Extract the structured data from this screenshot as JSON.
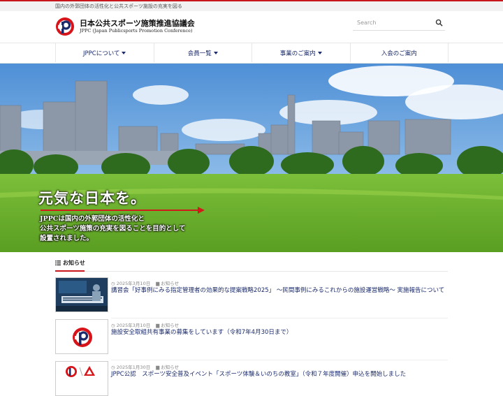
{
  "topbar": {
    "tagline": "国内の外郭団体の活性化と公共スポーツ施設の充実を図る"
  },
  "brand": {
    "title": "日本公共スポーツ施策推進協議会",
    "subtitle": "JPPC (Japan Publicsports Promotion Conference)",
    "color": "#d7141a"
  },
  "search": {
    "placeholder": "Search"
  },
  "nav": [
    {
      "label": "JPPCについて"
    },
    {
      "label": "会員一覧"
    },
    {
      "label": "事業のご案内"
    },
    {
      "label": "入会のご案内"
    }
  ],
  "hero": {
    "headline": "元気な日本を。",
    "body": [
      "JPPCは国内の外郭団体の活性化と",
      "公共スポーツ施策の充実を図ることを目的として",
      "設置されました。"
    ]
  },
  "news": {
    "heading": "お知らせ",
    "items": [
      {
        "date": "2025年3月10日",
        "category": "お知らせ",
        "title": "講習会「好事例にみる指定管理者の効果的な提案戦略2025」 ～民間事例にみるこれからの施設運営戦略～ 実施報告について"
      },
      {
        "date": "2025年3月10日",
        "category": "お知らせ",
        "title": "施設安全取組共有事業の募集をしています（令和7年4月30日まで）"
      },
      {
        "date": "2025年1月30日",
        "category": "お知らせ",
        "title": "JPPC公認　スポーツ安全普及イベント「スポーツ体験＆いのちの教室」（令和７年度開催）申込を開始しました"
      }
    ]
  }
}
